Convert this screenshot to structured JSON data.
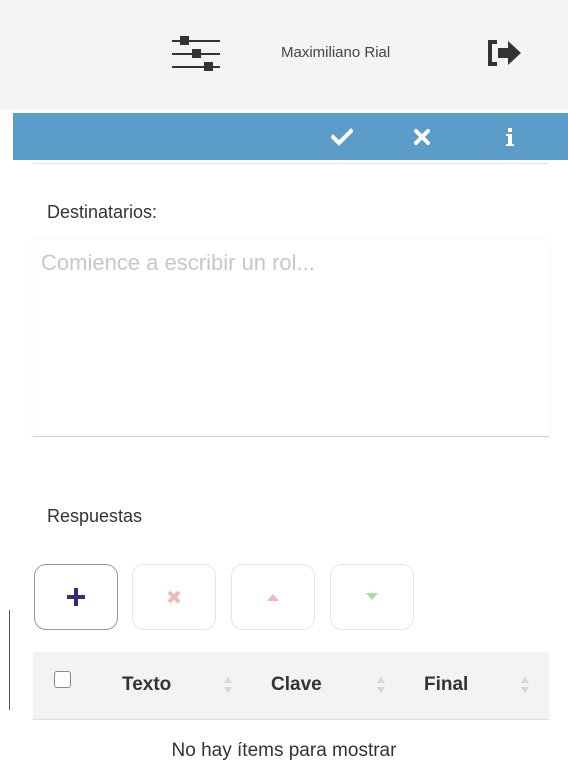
{
  "header": {
    "filters_icon": "sliders-icon",
    "user_name": "Maximiliano Rial",
    "logout_icon": "sign-out-icon",
    "background": "#f3f4f4"
  },
  "action_bar": {
    "background": "#5b9cc8",
    "buttons": [
      {
        "name": "confirm",
        "icon": "check-icon"
      },
      {
        "name": "cancel",
        "icon": "close-icon"
      },
      {
        "name": "info",
        "icon": "info-icon"
      }
    ]
  },
  "recipients": {
    "label": "Destinatarios:",
    "placeholder": "Comience a escribir un rol...",
    "value": ""
  },
  "answers": {
    "label": "Respuestas",
    "toolbar": [
      {
        "name": "add",
        "icon": "plus-icon",
        "color": "#3b2a7a",
        "enabled": true
      },
      {
        "name": "remove",
        "icon": "close-icon",
        "color": "#f4b6b6",
        "enabled": false
      },
      {
        "name": "move-up",
        "icon": "caret-up-icon",
        "color": "#f4b6b6",
        "enabled": false
      },
      {
        "name": "move-down",
        "icon": "caret-down-icon",
        "color": "#a9dca9",
        "enabled": false
      }
    ],
    "table": {
      "columns": [
        "Texto",
        "Clave",
        "Final"
      ],
      "rows": [],
      "empty_message": "No hay ítems para mostrar"
    }
  }
}
